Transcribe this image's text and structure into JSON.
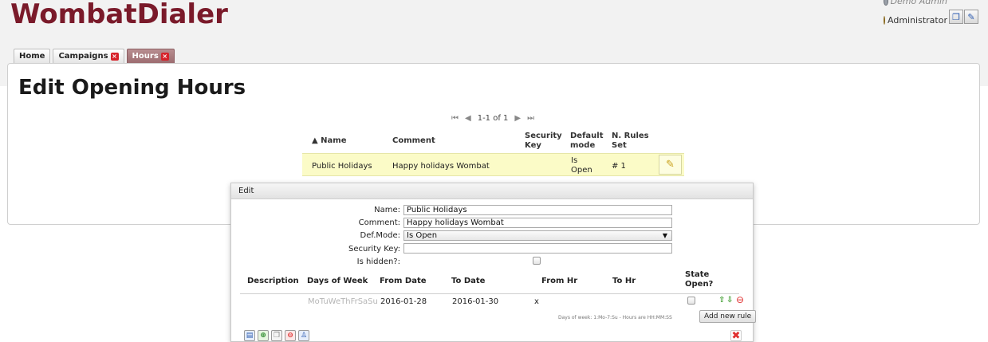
{
  "app": {
    "logo_text": "WombatDialer"
  },
  "user": {
    "name": "Demo Admin",
    "role": "Administrator"
  },
  "header_buttons": [
    {
      "icon": "window-edit-icon"
    },
    {
      "icon": "pencil-icon"
    }
  ],
  "tabs": [
    {
      "label": "Home"
    },
    {
      "label": "Campaigns"
    },
    {
      "label": "Hours"
    }
  ],
  "page": {
    "title": "Edit Opening Hours"
  },
  "pager": {
    "text": "1-1 of 1"
  },
  "grid": {
    "columns": [
      "▲ Name",
      "Comment",
      "Security Key",
      "Default mode",
      "N. Rules Set"
    ],
    "rows": [
      {
        "name": "Public Holidays",
        "comment": "Happy holidays Wombat",
        "security_key": "",
        "default_mode": "Is Open",
        "rules": "# 1"
      }
    ]
  },
  "dialog": {
    "title": "Edit",
    "fields": {
      "name_label": "Name:",
      "name_value": "Public Holidays",
      "comment_label": "Comment:",
      "comment_value": "Happy holidays Wombat",
      "mode_label": "Def.Mode:",
      "mode_value": "Is Open",
      "key_label": "Security Key:",
      "key_value": "",
      "hidden_label": "Is hidden?:"
    },
    "rules_columns": [
      "Description",
      "Days of Week",
      "From Date",
      "To Date",
      "From Hr",
      "To Hr",
      "State Open?"
    ],
    "rules": [
      {
        "description": "",
        "days": "MoTuWeThFrSaSu",
        "from_date": "2016-01-28",
        "to_date": "2016-01-30",
        "from_hr": "x",
        "to_hr": ""
      }
    ],
    "hint": "Days of week: 1:Mo-7:Su - Hours are HH:MM:SS",
    "add_rule_label": "Add new rule"
  },
  "colors": {
    "brand": "#7a1a2a",
    "active_tab": "#a37276",
    "selected_row": "#fbfbc7"
  }
}
